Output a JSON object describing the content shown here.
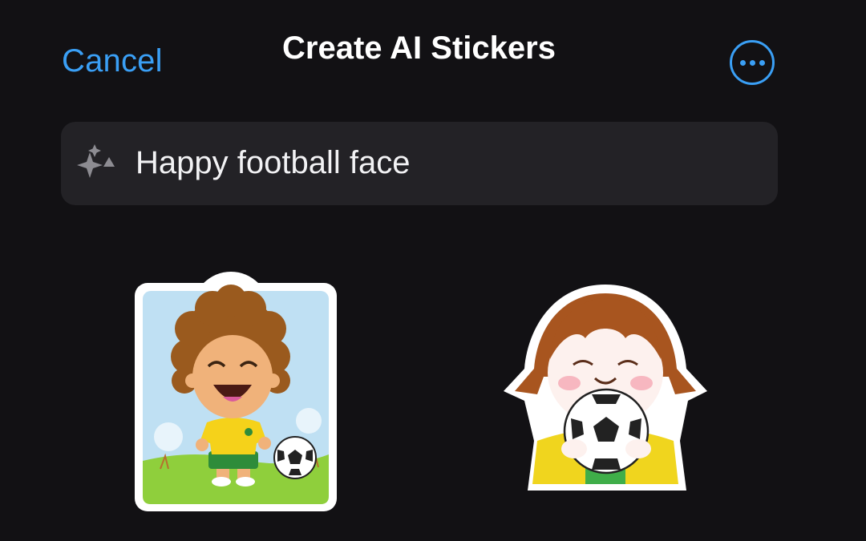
{
  "header": {
    "cancel_label": "Cancel",
    "title": "Create AI Stickers",
    "more_icon": "ellipsis-circle-icon"
  },
  "prompt": {
    "value": "Happy football face",
    "icon": "sparkles-icon"
  },
  "stickers": [
    {
      "name": "curly-hair-boy-with-football-sticker"
    },
    {
      "name": "girl-hugging-football-sticker"
    }
  ],
  "colors": {
    "background": "#121114",
    "accent": "#3a9ff5",
    "field": "#232226",
    "text": "#f2f2f4"
  }
}
